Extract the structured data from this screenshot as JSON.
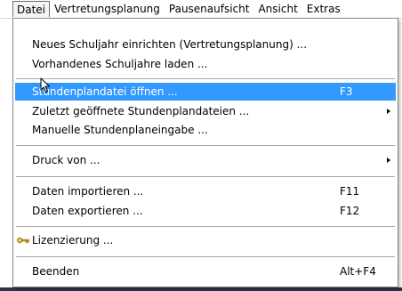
{
  "menubar": {
    "items": [
      {
        "label": "Datei"
      },
      {
        "label": "Vertretungsplanung"
      },
      {
        "label": "Pausenaufsicht"
      },
      {
        "label": "Ansicht"
      },
      {
        "label": "Extras"
      }
    ]
  },
  "menu": {
    "items": [
      {
        "label": "Neues Schuljahr einrichten (Vertretungsplanung) ...",
        "shortcut": ""
      },
      {
        "label": "Vorhandenes Schuljahre  laden ...",
        "shortcut": ""
      },
      {
        "label": "Stundenplandatei öffnen ...",
        "shortcut": "F3"
      },
      {
        "label": "Zuletzt geöffnete Stundenplandateien ...",
        "shortcut": ""
      },
      {
        "label": "Manuelle Stundenplaneingabe ...",
        "shortcut": ""
      },
      {
        "label": "Druck von ...",
        "shortcut": ""
      },
      {
        "label": "Daten importieren ...",
        "shortcut": "F11"
      },
      {
        "label": "Daten exportieren ...",
        "shortcut": "F12"
      },
      {
        "label": "Lizenzierung ...",
        "shortcut": ""
      },
      {
        "label": "Beenden",
        "shortcut": "Alt+F4"
      }
    ],
    "icons": {
      "lizenzierung": "key-icon"
    }
  },
  "colors": {
    "highlight": "#3399ff",
    "menu_border": "#868686",
    "separator": "#a8a8a8"
  }
}
